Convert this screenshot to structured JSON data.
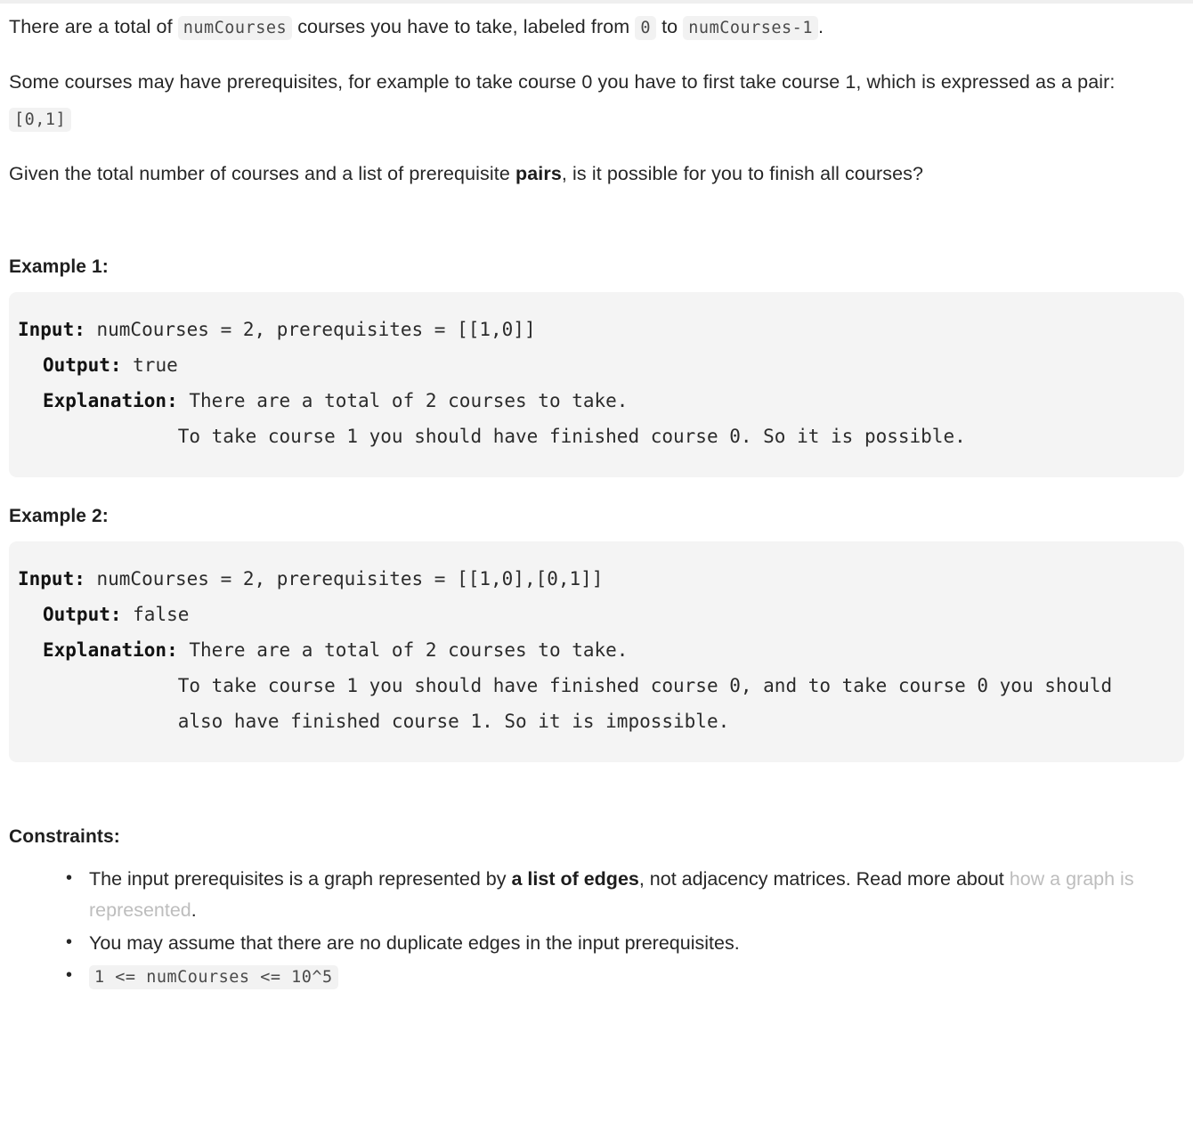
{
  "intro": {
    "p1_a": "There are a total of ",
    "p1_code1": "numCourses",
    "p1_b": " courses you have to take, labeled from ",
    "p1_code2": "0",
    "p1_c": " to ",
    "p1_code3": "numCourses-1",
    "p1_d": ".",
    "p2_a": "Some courses may have prerequisites, for example to take course 0 you have to first take course 1, which is expressed as a pair: ",
    "p2_code": "[0,1]",
    "p3_a": "Given the total number of courses and a list of prerequisite ",
    "p3_bold": "pairs",
    "p3_b": ", is it possible for you to finish all courses?"
  },
  "example1": {
    "heading": "Example 1:",
    "input_label": "Input:",
    "input_value": " numCourses = 2, prerequisites = [[1,0]]",
    "output_label": "Output:",
    "output_value": " true",
    "explanation_label": "Explanation:",
    "explanation_value": " There are a total of 2 courses to take. \n            To take course 1 you should have finished course 0. So it is possible."
  },
  "example2": {
    "heading": "Example 2:",
    "input_label": "Input:",
    "input_value": " numCourses = 2, prerequisites = [[1,0],[0,1]]",
    "output_label": "Output:",
    "output_value": " false",
    "explanation_label": "Explanation:",
    "explanation_value": " There are a total of 2 courses to take. \n            To take course 1 you should have finished course 0, and to take course 0 you should \n            also have finished course 1. So it is impossible."
  },
  "constraints": {
    "heading": "Constraints:",
    "item1_a": "The input prerequisites is a graph represented by ",
    "item1_bold": "a list of edges",
    "item1_b": ", not adjacency matrices. Read more about ",
    "item1_link": "how a graph is represented",
    "item1_c": ".",
    "item2": "You may assume that there are no duplicate edges in the input prerequisites.",
    "item3_code": "1 <= numCourses <= 10^5"
  },
  "colors": {
    "text": "#262626",
    "inline_code_bg": "#f2f2f2",
    "code_block_bg": "#f4f4f4",
    "link": "#bdbdbd"
  }
}
